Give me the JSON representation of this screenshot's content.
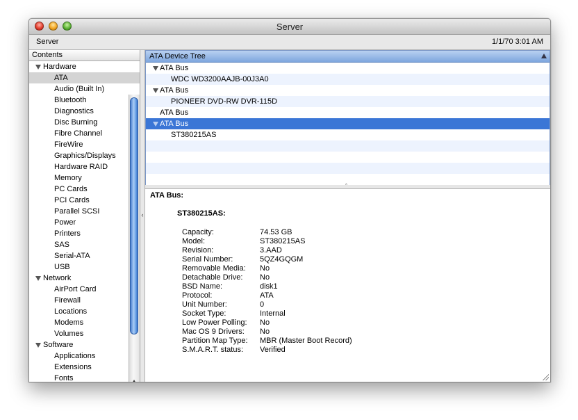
{
  "window": {
    "title": "Server"
  },
  "infobar": {
    "machine": "Server",
    "datetime": "1/1/70 3:01 AM"
  },
  "sidebar": {
    "header": "Contents",
    "sections": [
      {
        "label": "Hardware",
        "items": [
          "ATA",
          "Audio (Built In)",
          "Bluetooth",
          "Diagnostics",
          "Disc Burning",
          "Fibre Channel",
          "FireWire",
          "Graphics/Displays",
          "Hardware RAID",
          "Memory",
          "PC Cards",
          "PCI Cards",
          "Parallel SCSI",
          "Power",
          "Printers",
          "SAS",
          "Serial-ATA",
          "USB"
        ]
      },
      {
        "label": "Network",
        "items": [
          "AirPort Card",
          "Firewall",
          "Locations",
          "Modems",
          "Volumes"
        ]
      },
      {
        "label": "Software",
        "items": [
          "Applications",
          "Extensions",
          "Fonts"
        ]
      }
    ],
    "selected_item": "ATA"
  },
  "device_tree": {
    "header": "ATA Device Tree",
    "rows": [
      {
        "label": "ATA Bus",
        "level": 0,
        "expanded": true
      },
      {
        "label": "WDC WD3200AAJB-00J3A0",
        "level": 1
      },
      {
        "label": "ATA Bus",
        "level": 0,
        "expanded": true
      },
      {
        "label": "PIONEER DVD-RW  DVR-115D",
        "level": 1
      },
      {
        "label": "ATA Bus",
        "level": 0,
        "expanded": false
      },
      {
        "label": "ATA Bus",
        "level": 0,
        "expanded": true,
        "selected": true
      },
      {
        "label": "ST380215AS",
        "level": 1
      },
      {
        "label": "",
        "level": 0
      },
      {
        "label": "",
        "level": 0
      },
      {
        "label": "",
        "level": 0
      },
      {
        "label": "",
        "level": 0
      }
    ]
  },
  "detail": {
    "heading": "ATA Bus:",
    "device": "ST380215AS:",
    "properties": [
      {
        "key": "Capacity:",
        "value": "74.53 GB"
      },
      {
        "key": "Model:",
        "value": "ST380215AS"
      },
      {
        "key": "Revision:",
        "value": "3.AAD"
      },
      {
        "key": "Serial Number:",
        "value": "5QZ4GQGM"
      },
      {
        "key": "Removable Media:",
        "value": "No"
      },
      {
        "key": "Detachable Drive:",
        "value": "No"
      },
      {
        "key": "BSD Name:",
        "value": "disk1"
      },
      {
        "key": "Protocol:",
        "value": "ATA"
      },
      {
        "key": "Unit Number:",
        "value": "0"
      },
      {
        "key": "Socket Type:",
        "value": "Internal"
      },
      {
        "key": "Low Power Polling:",
        "value": "No"
      },
      {
        "key": "Mac OS 9 Drivers:",
        "value": "No"
      },
      {
        "key": "Partition Map Type:",
        "value": "MBR (Master Boot Record)"
      },
      {
        "key": "S.M.A.R.T. status:",
        "value": "Verified"
      }
    ]
  }
}
